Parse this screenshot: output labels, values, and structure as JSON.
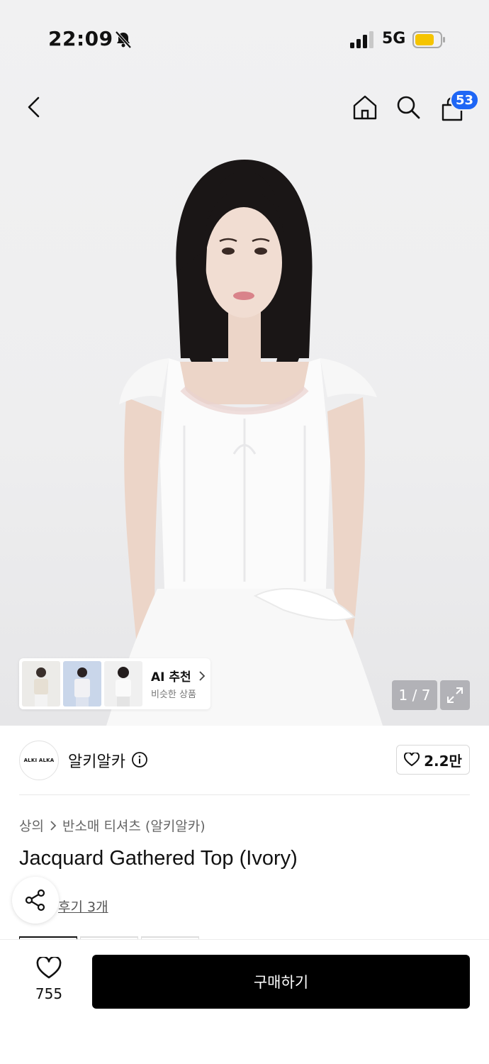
{
  "status_bar": {
    "time": "22:09",
    "network": "5G",
    "icons": [
      "bell-slash-icon",
      "signal-icon",
      "battery-icon"
    ],
    "battery_color": "#f5c400"
  },
  "header": {
    "icons": [
      "back-icon",
      "home-icon",
      "search-icon",
      "cart-icon"
    ],
    "cart_count": "53",
    "badge_color": "#1e66f5"
  },
  "gallery": {
    "counter": "1 / 7",
    "ai_card": {
      "title": "AI 추천",
      "subtitle": "비슷한 상품"
    }
  },
  "brand": {
    "logo_text": "ALKI ALKA",
    "name": "알키알카",
    "likes": "2.2만"
  },
  "product": {
    "breadcrumb": [
      "상의",
      "반소매 티셔츠 (알키알카)"
    ],
    "title": "Jacquard Gathered Top (Ivory)",
    "review_link": "후기 3개"
  },
  "bottom_bar": {
    "wish_count": "755",
    "buy_label": "구매하기"
  }
}
